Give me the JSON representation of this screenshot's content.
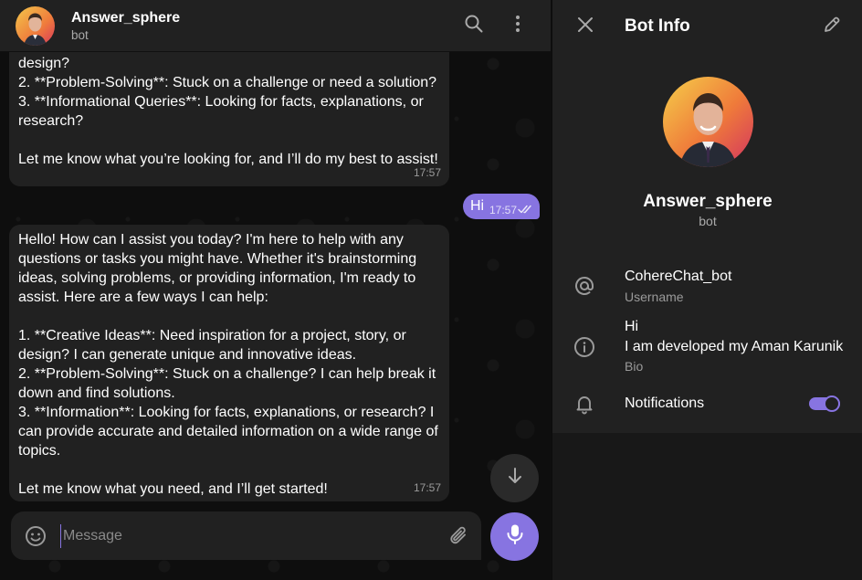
{
  "chat": {
    "title": "Answer_sphere",
    "subtitle": "bot",
    "messages": [
      {
        "direction": "in",
        "lines": [
          "design?",
          "2. **Problem-Solving**: Stuck on a challenge or need a solution?",
          "3. **Informational Queries**: Looking for facts, explanations, or",
          "research?",
          "",
          "Let me know what you’re looking for, and I’ll do my best to assist!"
        ],
        "time": "17:57"
      },
      {
        "direction": "out",
        "text": "Hi",
        "time": "17:57",
        "status": "read"
      },
      {
        "direction": "in",
        "lines": [
          "Hello! How can I assist you today? I'm here to help with any",
          "questions or tasks you might have. Whether it's brainstorming",
          "ideas, solving problems, or providing information, I'm ready to",
          "assist. Here are a few ways I can help:",
          "",
          "1. **Creative Ideas**: Need inspiration for a project, story, or",
          "design? I can generate unique and innovative ideas.",
          "2. **Problem-Solving**: Stuck on a challenge? I can help break it",
          "down and find solutions.",
          "3. **Information**: Looking for facts, explanations, or research? I",
          "can provide accurate and detailed information on a wide range of",
          "topics.",
          "",
          "Let me know what you need, and I’ll get started!"
        ],
        "time": "17:57"
      }
    ],
    "composer": {
      "placeholder": "Message",
      "value": ""
    }
  },
  "panel": {
    "title": "Bot Info",
    "profile": {
      "name": "Answer_sphere",
      "subtitle": "bot"
    },
    "username": {
      "value": "CohereChat_bot",
      "caption": "Username"
    },
    "bio": {
      "lines": [
        "Hi",
        "I am developed my Aman Karunik"
      ],
      "caption": "Bio"
    },
    "notifications": {
      "label": "Notifications",
      "enabled": true
    }
  },
  "colors": {
    "accent": "#8774e1",
    "bubble_in": "#212121",
    "panel_bg": "#212121",
    "secondary_text": "#aaaaaa"
  },
  "icons": [
    "search-icon",
    "more-vertical-icon",
    "close-icon",
    "edit-icon",
    "at-sign-icon",
    "info-icon",
    "bell-icon",
    "emoji-icon",
    "attach-icon",
    "mic-icon",
    "arrow-down-icon",
    "double-check-icon"
  ]
}
